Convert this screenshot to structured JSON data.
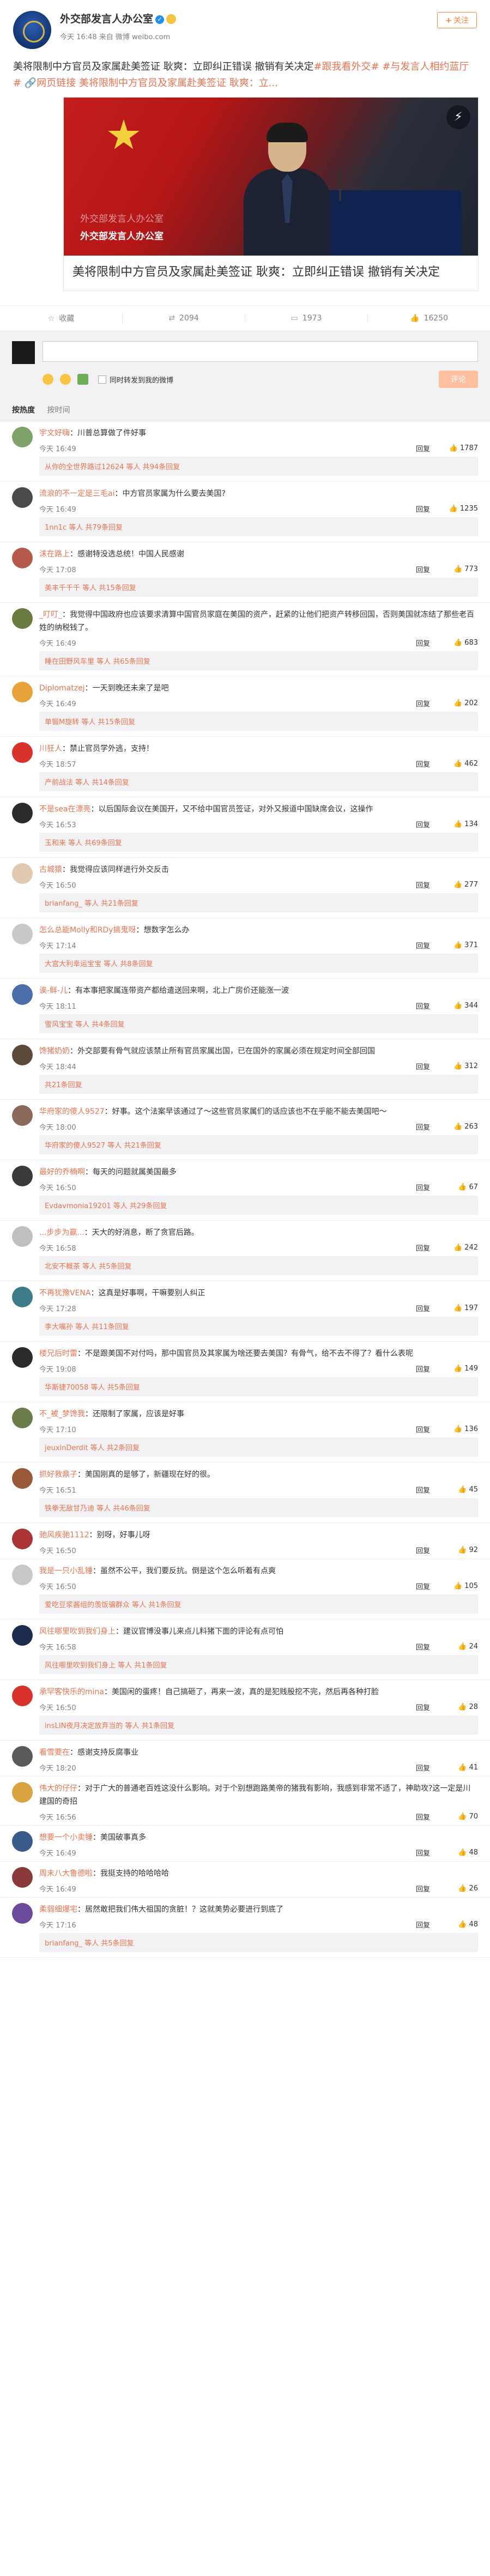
{
  "post": {
    "author": "外交部发言人办公室",
    "time": "今天 16:48",
    "source": "来自 微博 weibo.com",
    "follow_label": "关注",
    "text_pre": "美将限制中方官员及家属赴美签证   耿爽：立即纠正错误 撤销有关决定",
    "text_tags": "#跟我看外交# #与发言人相约蓝厅#",
    "text_link": "网页链接",
    "text_link_detail": "美将限制中方官员及家属赴美签证   耿爽：立...",
    "card_watermark_top": "外交部发言人办公室",
    "card_watermark": "外交部发言人办公室",
    "card_title": "美将限制中方官员及家属赴美签证   耿爽：立即纠正错误 撤销有关决定",
    "colors": {
      "accent": "#eb7350",
      "brand": "#ff8140"
    }
  },
  "actions": {
    "favorite": "收藏",
    "repost": "2094",
    "comment": "1973",
    "like": "16250"
  },
  "composer": {
    "also_repost": "同时转发到我的微博",
    "submit": "评论"
  },
  "sort": {
    "hot": "按热度",
    "time": "按时间"
  },
  "comments": [
    {
      "user": "宇文好嗨",
      "text": "川普总算做了件好事",
      "time": "今天 16:49",
      "likes": "1787",
      "reply": "回复",
      "avatar": "#7fa26b",
      "more": "从你的全世界路过12624 等人 共94条回复"
    },
    {
      "user": "流浪的不一定是三毛ai",
      "text": "中方官员家属为什么要去美国?",
      "time": "今天 16:49",
      "likes": "1235",
      "reply": "回复",
      "avatar": "#4a4a4a",
      "more": "1nn1c 等人 共79条回复"
    },
    {
      "user": "沫在路上",
      "text": "感谢特没选总统！中国人民感谢",
      "time": "今天 17:08",
      "likes": "773",
      "reply": "回复",
      "avatar": "#b5594b",
      "more": "美丰千千千 等人 共15条回复"
    },
    {
      "user": "_叮叮_",
      "text": "我觉得中国政府也应该要求清算中国官员家庭在美国的资产，赶紧的让他们把资产转移回国，否则美国就冻结了那些老百姓的纳税钱了。",
      "time": "今天 16:49",
      "likes": "683",
      "reply": "回复",
      "avatar": "#6a7b3f",
      "more": "睡在田野风车里 等人 共65条回复"
    },
    {
      "user": "Diplomatzej",
      "text": "一天到晚还未来了是吧",
      "time": "今天 16:49",
      "likes": "202",
      "reply": "回复",
      "avatar": "#e7a23b",
      "more": "单锻M旋转 等人 共15条回复"
    },
    {
      "user": "川狂人",
      "text": "禁止官员学外逃，支持！",
      "time": "今天 18:57",
      "likes": "462",
      "reply": "回复",
      "avatar": "#d8322b",
      "more": "产前战法 等人 共14条回复"
    },
    {
      "user": "不是sea在漂亮",
      "text": "以后国际会议在美国开，又不给中国官员签证，对外又报道中国缺席会议，这操作",
      "time": "今天 16:53",
      "likes": "134",
      "reply": "回复",
      "avatar": "#2b2b2b",
      "more": "玉和来 等人 共69条回复"
    },
    {
      "user": "古城猿",
      "text": "我觉得应该同样进行外交反击",
      "time": "今天 16:50",
      "likes": "277",
      "reply": "回复",
      "avatar": "#e0c9b0",
      "more": "brianfang_ 等人 共21条回复"
    },
    {
      "user": "怎么总能Molly和RDy搞鬼呀",
      "text": "想数字怎么办",
      "time": "今天 17:14",
      "likes": "371",
      "reply": "回复",
      "avatar": "#c9c9c9",
      "more": "大宫大利幸运宝宝 等人 共8条回复"
    },
    {
      "user": "诶-鲜-儿",
      "text": "有本事把家属连带资产都给遣送回来啊，北上广房价还能涨一波",
      "time": "今天 18:11",
      "likes": "344",
      "reply": "回复",
      "avatar": "#4b6ea8",
      "more": "雪风宝宝 等人 共4条回复"
    },
    {
      "user": "馋猪奶奶",
      "text": "外交部要有骨气就应该禁止所有官员家属出国，已在国外的家属必须在规定时间全部回国",
      "time": "今天 18:44",
      "likes": "312",
      "reply": "回复",
      "avatar": "#5c4a3a",
      "more": "共21条回复"
    },
    {
      "user": "华府家的傻人9527",
      "text": "好事。这个法案早该通过了～这些官员家属们的话应该也不在乎能不能去美国吧～",
      "time": "今天 18:00",
      "likes": "263",
      "reply": "回复",
      "avatar": "#8a6a5a",
      "more": "华府家的傻人9527 等人 共21条回复"
    },
    {
      "user": "最好的乔楠啊",
      "text": "每天的问题就属美国最多",
      "time": "今天 16:50",
      "likes": "67",
      "reply": "回复",
      "avatar": "#3a3a3a",
      "more": "Evdavmonia19201 等人 共29条回复"
    },
    {
      "user": "...步步为赢...",
      "text": "天大的好消息，断了贪官后路。",
      "time": "今天 16:58",
      "likes": "242",
      "reply": "回复",
      "avatar": "#bfbfbf",
      "more": "北安不概茶 等人 共5条回复"
    },
    {
      "user": "不再犹豫VENA",
      "text": "这真是好事啊，干嘛要别人纠正",
      "time": "今天 17:28",
      "likes": "197",
      "reply": "回复",
      "avatar": "#3d7a8a",
      "more": "李大嘴孙 等人 共11条回复"
    },
    {
      "user": "楼兄后时雷",
      "text": "不是跟美国不对付吗，那中国官员及其家属为啥还要去美国？有骨气，给不去不得了？看什么表呢",
      "time": "今天 19:08",
      "likes": "149",
      "reply": "回复",
      "avatar": "#2a2a2a",
      "more": "华斯捷70058 等人 共5条回复"
    },
    {
      "user": "不_被_梦馋我",
      "text": "还限制了家属，应该是好事",
      "time": "今天 17:10",
      "likes": "136",
      "reply": "回复",
      "avatar": "#6b7d4a",
      "more": "jeuxinDerdit 等人 共2条回复"
    },
    {
      "user": "抓好救鼎子",
      "text": "美国刚真的是够了，新疆现在好的很。",
      "time": "今天 16:51",
      "likes": "45",
      "reply": "回复",
      "avatar": "#9a5a3a",
      "more": "铁拳无敌甘乃迪 等人 共46条回复"
    },
    {
      "user": "驰风疾驰1112",
      "text": "别呀，好事儿呀",
      "time": "今天 16:50",
      "likes": "92",
      "reply": "回复",
      "avatar": "#a33",
      "more": ""
    },
    {
      "user": "我是一只小乱锤",
      "text": "虽然不公平，我们要反抗。倒是这个怎么听着有点爽",
      "time": "今天 16:50",
      "likes": "105",
      "reply": "回复",
      "avatar": "#c8c8c8",
      "more": "爱吃豆浆酱组的羡饭骗群众 等人 共1条回复"
    },
    {
      "user": "风往哪里吹到我们身上",
      "text": "建议官博没事儿来点儿料猪下面的评论有点可怕",
      "time": "今天 16:58",
      "likes": "24",
      "reply": "回复",
      "avatar": "#1d2b4f",
      "more": "风往哪里吹到我们身上 等人 共1条回复"
    },
    {
      "user": "承罕客快乐的mina",
      "text": "美国闲的蛋疼！自己搞砸了，再来一波，真的是犯贱股挖不完，然后再各种打脸",
      "time": "今天 16:50",
      "likes": "28",
      "reply": "回复",
      "avatar": "#d8322b",
      "more": "insLIN夜月决定放弃当的 等人 共1条回复"
    },
    {
      "user": "看雪要在",
      "text": "感谢支持反腐事业",
      "time": "今天 18:20",
      "likes": "41",
      "reply": "回复",
      "avatar": "#5a5a5a",
      "more": ""
    },
    {
      "user": "伟大的仔仔",
      "text": "对于广大的普通老百姓这没什么影响。对于个别想跑路美帝的猪我有影响，我感到非常不适了，神助攻?这一定是川建国的奇招",
      "time": "今天 16:56",
      "likes": "70",
      "reply": "回复",
      "avatar": "#d9a441",
      "more": ""
    },
    {
      "user": "想要一个小卖锤",
      "text": "美国破事真多",
      "time": "今天 16:49",
      "likes": "48",
      "reply": "回复",
      "avatar": "#3a5a8a",
      "more": ""
    },
    {
      "user": "周末八大鲁德啦",
      "text": "我挺支持的哈哈哈哈",
      "time": "今天 16:49",
      "likes": "26",
      "reply": "回复",
      "avatar": "#8a3a3a",
      "more": ""
    },
    {
      "user": "柔弱细爆宅",
      "text": "居然敢把我们伟大祖国的贪脏！？这就美势必要进行到底了",
      "time": "今天 17:16",
      "likes": "48",
      "reply": "回复",
      "avatar": "#6a4a9a",
      "more": "brianfang_ 等人 共5条回复"
    }
  ]
}
